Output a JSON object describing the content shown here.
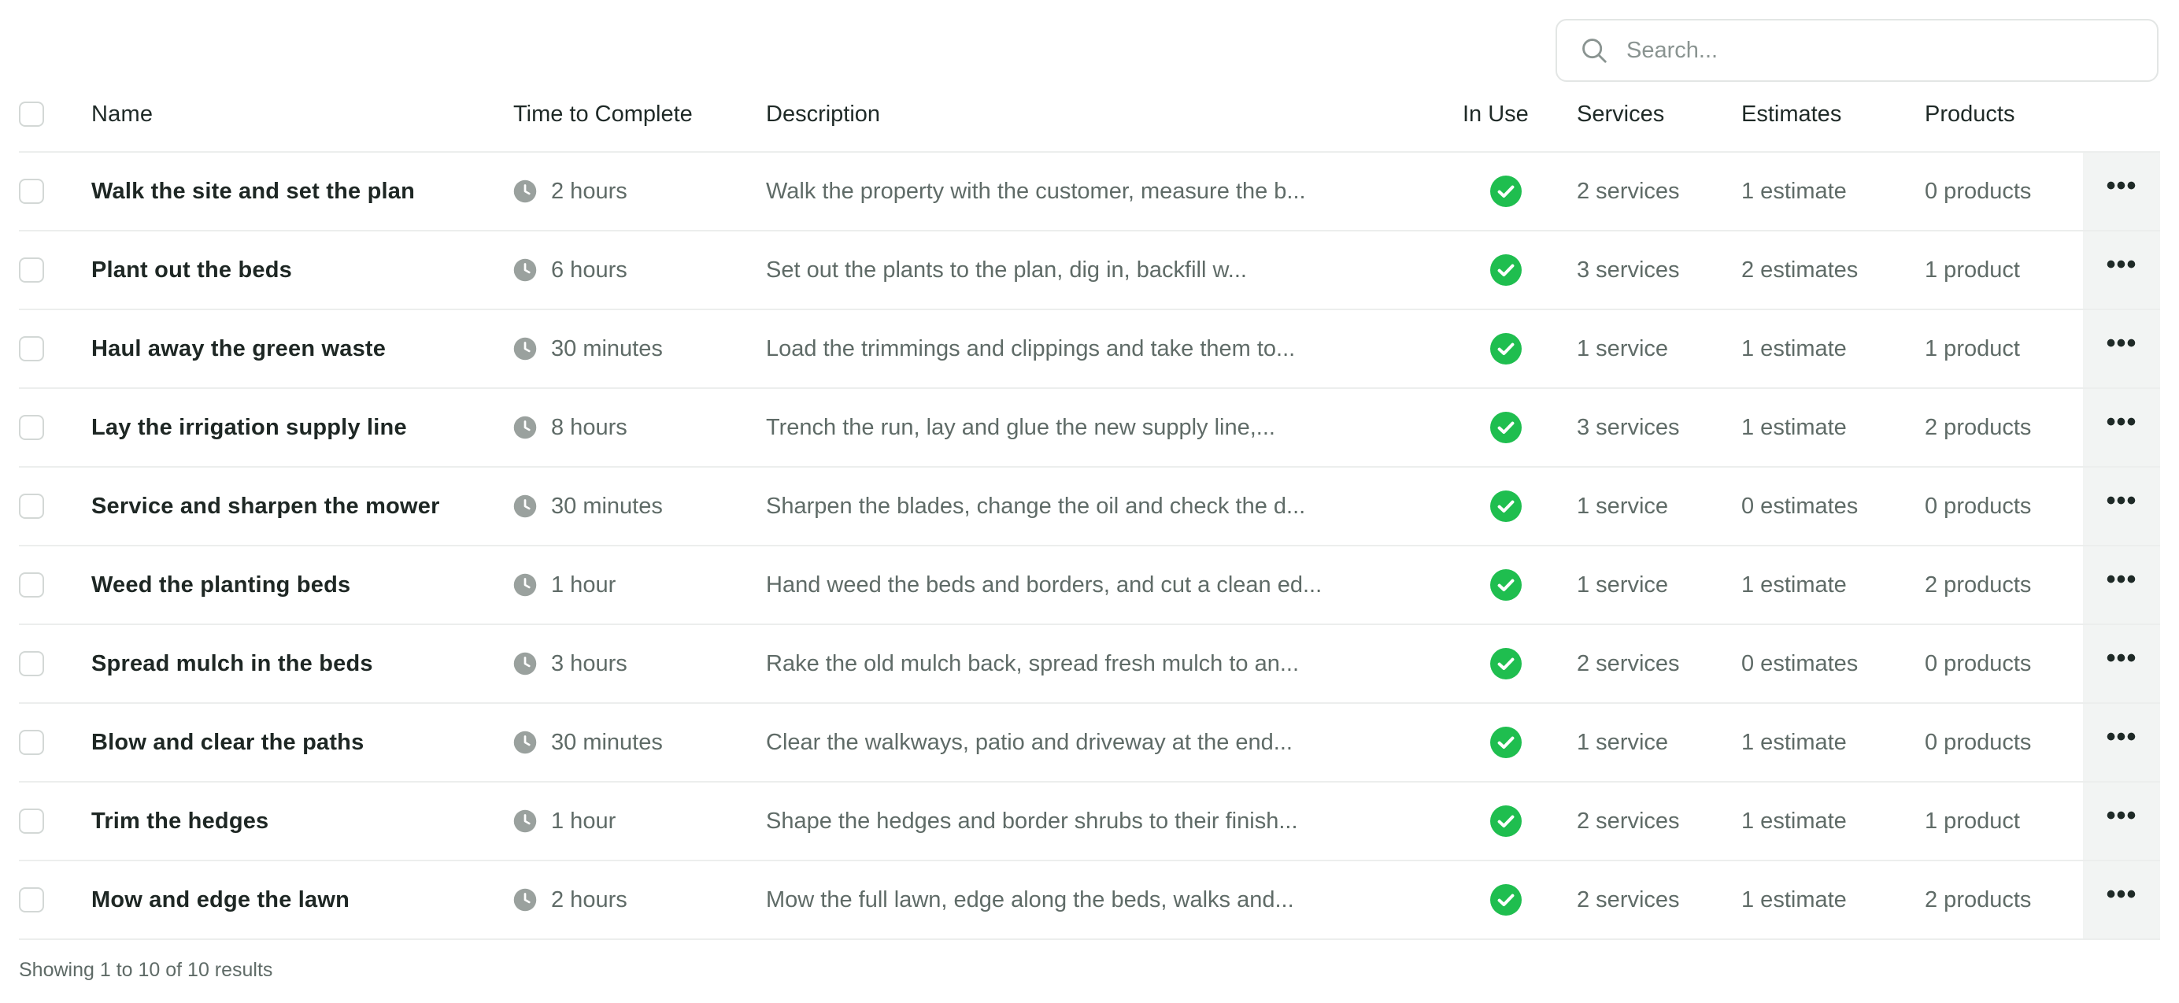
{
  "search": {
    "placeholder": "Search..."
  },
  "columns": {
    "name": "Name",
    "time": "Time to Complete",
    "description": "Description",
    "in_use": "In Use",
    "services": "Services",
    "estimates": "Estimates",
    "products": "Products"
  },
  "rows": [
    {
      "name": "Walk the site and set the plan",
      "time": "2 hours",
      "description": "Walk the property with the customer, measure the b...",
      "in_use": true,
      "services": "2 services",
      "estimates": "1 estimate",
      "products": "0 products"
    },
    {
      "name": "Plant out the beds",
      "time": "6 hours",
      "description": "Set out the plants to the plan, dig in, backfill w...",
      "in_use": true,
      "services": "3 services",
      "estimates": "2 estimates",
      "products": "1 product"
    },
    {
      "name": "Haul away the green waste",
      "time": "30 minutes",
      "description": "Load the trimmings and clippings and take them to...",
      "in_use": true,
      "services": "1 service",
      "estimates": "1 estimate",
      "products": "1 product"
    },
    {
      "name": "Lay the irrigation supply line",
      "time": "8 hours",
      "description": "Trench the run, lay and glue the new supply line,...",
      "in_use": true,
      "services": "3 services",
      "estimates": "1 estimate",
      "products": "2 products"
    },
    {
      "name": "Service and sharpen the mower",
      "time": "30 minutes",
      "description": "Sharpen the blades, change the oil and check the d...",
      "in_use": true,
      "services": "1 service",
      "estimates": "0 estimates",
      "products": "0 products"
    },
    {
      "name": "Weed the planting beds",
      "time": "1 hour",
      "description": "Hand weed the beds and borders, and cut a clean ed...",
      "in_use": true,
      "services": "1 service",
      "estimates": "1 estimate",
      "products": "2 products"
    },
    {
      "name": "Spread mulch in the beds",
      "time": "3 hours",
      "description": "Rake the old mulch back, spread fresh mulch to an...",
      "in_use": true,
      "services": "2 services",
      "estimates": "0 estimates",
      "products": "0 products"
    },
    {
      "name": "Blow and clear the paths",
      "time": "30 minutes",
      "description": "Clear the walkways, patio and driveway at the end...",
      "in_use": true,
      "services": "1 service",
      "estimates": "1 estimate",
      "products": "0 products"
    },
    {
      "name": "Trim the hedges",
      "time": "1 hour",
      "description": "Shape the hedges and border shrubs to their finish...",
      "in_use": true,
      "services": "2 services",
      "estimates": "1 estimate",
      "products": "1 product"
    },
    {
      "name": "Mow and edge the lawn",
      "time": "2 hours",
      "description": "Mow the full lawn, edge along the beds, walks and...",
      "in_use": true,
      "services": "2 services",
      "estimates": "1 estimate",
      "products": "2 products"
    }
  ],
  "footer": {
    "summary": "Showing 1 to 10 of 10 results"
  },
  "icons": {
    "search": "search-icon",
    "clock": "clock-icon",
    "in_use": "check-circle-icon",
    "actions": "more-horizontal-icon"
  },
  "colors": {
    "in_use_green": "#1fbe4f",
    "clock_gray": "#9aa19e",
    "actions_bg": "#f2f4f3"
  }
}
